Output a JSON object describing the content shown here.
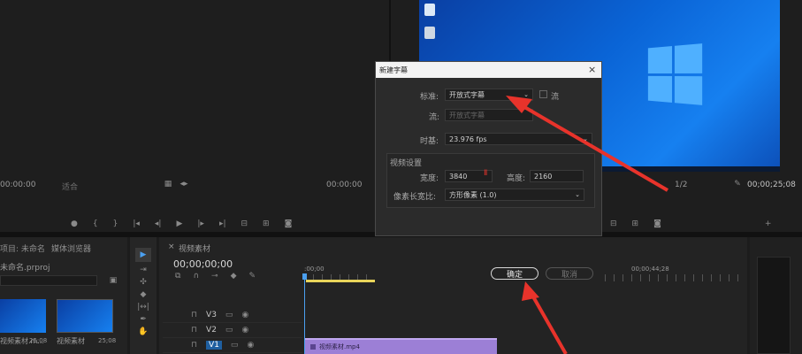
{
  "source_monitor": {
    "timecode_left": "00:00:00",
    "zoom": "适合",
    "timecode_right": "00:00:00"
  },
  "program_monitor": {
    "timecode_right": "00;00;25;08",
    "zoom": "1/2"
  },
  "project_panel": {
    "tab1": "项目: 未命名",
    "tab2": "媒体浏览器",
    "project_name": "未命名.prproj",
    "items": [
      {
        "name": "视频素材.m...",
        "dur": "25;08"
      },
      {
        "name": "视频素材",
        "dur": "25;08"
      }
    ]
  },
  "timeline": {
    "tab": "视频素材",
    "timecode": "00;00;00;00",
    "ruler_start": ":00;00",
    "ruler_end": "00;00;44;28",
    "tracks": [
      "V3",
      "V2",
      "V1"
    ],
    "clip": "视频素材.mp4"
  },
  "dialog": {
    "title": "新建字幕",
    "standard_label": "标准:",
    "standard_value": "开放式字幕",
    "checkbox_label": "流",
    "stream_label": "流:",
    "stream_value": "开放式字幕",
    "timebase_label": "时基:",
    "timebase_value": "23.976 fps",
    "video_section": "视频设置",
    "width_label": "宽度:",
    "width_value": "3840",
    "height_label": "高度:",
    "height_value": "2160",
    "par_label": "像素长宽比:",
    "par_value": "方形像素 (1.0)",
    "ok": "确定",
    "cancel": "取消"
  },
  "colors": {
    "accent": "#2d8ceb",
    "clip": "#9c7fd6",
    "arrow": "#e8332b",
    "desktop": "#0a64d6"
  }
}
